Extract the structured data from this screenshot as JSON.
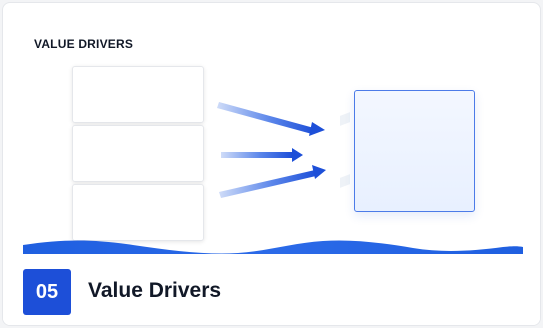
{
  "header": {
    "title": "VALUE DRIVERS"
  },
  "footer": {
    "number": "05",
    "title": "Value Drivers"
  },
  "diagram": {
    "source_count": 3,
    "arrow_color": "#1d4fd8",
    "target_border_color": "#4c7be8",
    "wave_color": "#1f5fe0"
  }
}
